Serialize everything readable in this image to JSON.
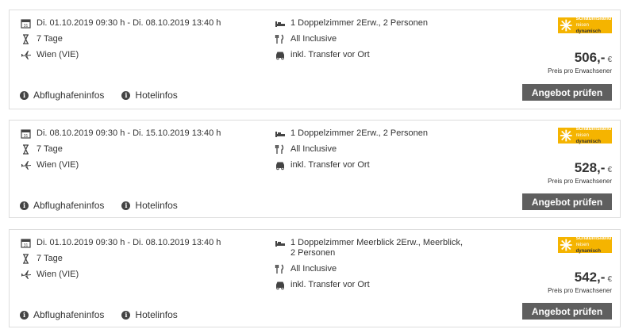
{
  "offers": [
    {
      "dates": "Di. 01.10.2019 09:30 h - Di. 08.10.2019 13:40 h",
      "duration": "7 Tage",
      "airport": "Wien (VIE)",
      "room": "1 Doppelzimmer 2Erw., 2 Personen",
      "board": "All Inclusive",
      "transfer": "inkl. Transfer vor Ort",
      "price": "506,-",
      "currency": "€",
      "price_note": "Preis pro Erwachsener",
      "cta": "Angebot prüfen",
      "link_airport": "Abflughafeninfos",
      "link_hotel": "Hotelinfos",
      "logo_line1": "schauinsland",
      "logo_line2a": "reisen",
      "logo_line2b": "dynamisch"
    },
    {
      "dates": "Di. 08.10.2019 09:30 h - Di. 15.10.2019 13:40 h",
      "duration": "7 Tage",
      "airport": "Wien (VIE)",
      "room": "1 Doppelzimmer 2Erw., 2 Personen",
      "board": "All Inclusive",
      "transfer": "inkl. Transfer vor Ort",
      "price": "528,-",
      "currency": "€",
      "price_note": "Preis pro Erwachsener",
      "cta": "Angebot prüfen",
      "link_airport": "Abflughafeninfos",
      "link_hotel": "Hotelinfos",
      "logo_line1": "schauinsland",
      "logo_line2a": "reisen",
      "logo_line2b": "dynamisch"
    },
    {
      "dates": "Di. 01.10.2019 09:30 h - Di. 08.10.2019 13:40 h",
      "duration": "7 Tage",
      "airport": "Wien (VIE)",
      "room": "1 Doppelzimmer Meerblick 2Erw., Meerblick, 2 Personen",
      "board": "All Inclusive",
      "transfer": "inkl. Transfer vor Ort",
      "price": "542,-",
      "currency": "€",
      "price_note": "Preis pro Erwachsener",
      "cta": "Angebot prüfen",
      "link_airport": "Abflughafeninfos",
      "link_hotel": "Hotelinfos",
      "logo_line1": "schauinsland",
      "logo_line2a": "reisen",
      "logo_line2b": "dynamisch"
    }
  ],
  "colors": {
    "button_bg": "#5f5f5f",
    "logo_bg": "#f5b400",
    "border": "#dddddd"
  },
  "icons": {
    "calendar": "calendar-icon",
    "hourglass": "hourglass-icon",
    "plane": "plane-icon",
    "bed": "bed-icon",
    "cutlery": "cutlery-icon",
    "car": "car-icon",
    "info": "info-icon"
  }
}
